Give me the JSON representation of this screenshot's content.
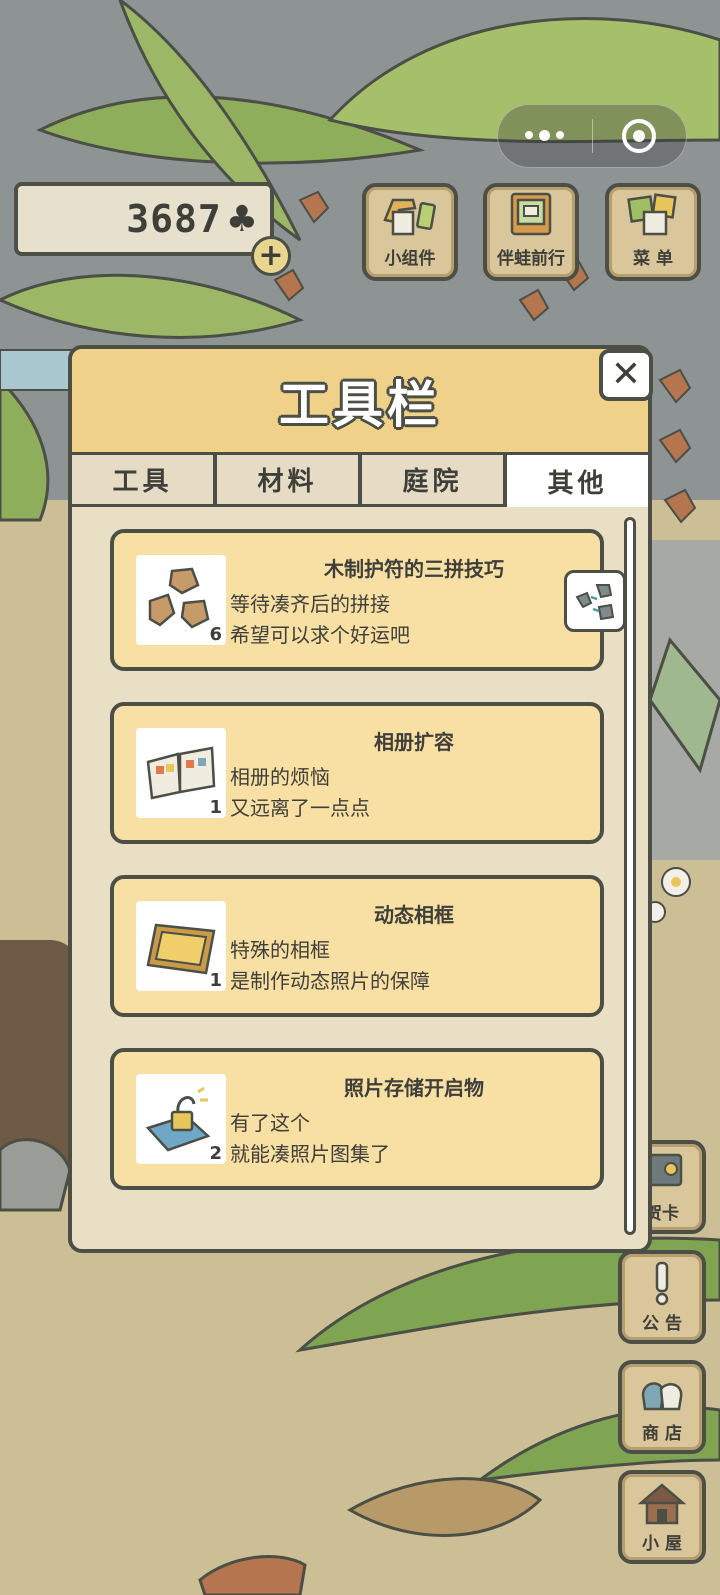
{
  "top_bar": {
    "clover_count": "3687",
    "clover_symbol": "♣",
    "plus_symbol": "+"
  },
  "menu_buttons": [
    {
      "label": "小组件",
      "icon": "widget-icon"
    },
    {
      "label": "伴蛙前行",
      "icon": "album-icon"
    },
    {
      "label": "菜 单",
      "icon": "menu-icon"
    }
  ],
  "side_buttons": [
    {
      "label": "贺卡",
      "icon": "card-icon"
    },
    {
      "label": "公 告",
      "icon": "notice-icon"
    },
    {
      "label": "商 店",
      "icon": "shop-icon"
    },
    {
      "label": "小 屋",
      "icon": "house-icon"
    }
  ],
  "panel": {
    "title": "工具栏",
    "close_symbol": "✕",
    "tabs": [
      {
        "label": "工具",
        "active": false
      },
      {
        "label": "材料",
        "active": false
      },
      {
        "label": "庭院",
        "active": false
      },
      {
        "label": "其他",
        "active": true
      }
    ],
    "items": [
      {
        "name": "木制护符的三拼技巧",
        "line1": "等待凑齐后的拼接",
        "line2": "希望可以求个好运吧",
        "quantity": "6",
        "icon": "wood-pieces-icon"
      },
      {
        "name": "相册扩容",
        "line1": "相册的烦恼",
        "line2": "又远离了一点点",
        "quantity": "1",
        "icon": "album-book-icon"
      },
      {
        "name": "动态相框",
        "line1": "特殊的相框",
        "line2": "是制作动态照片的保障",
        "quantity": "1",
        "icon": "photo-frame-icon"
      },
      {
        "name": "照片存储开启物",
        "line1": "有了这个",
        "line2": "就能凑照片图集了",
        "quantity": "2",
        "icon": "unlock-icon"
      }
    ]
  },
  "colors": {
    "outline": "#4b4f46",
    "header": "#f0d18a",
    "card": "#f8dfa4",
    "panel_bg": "#e9dfc4"
  }
}
